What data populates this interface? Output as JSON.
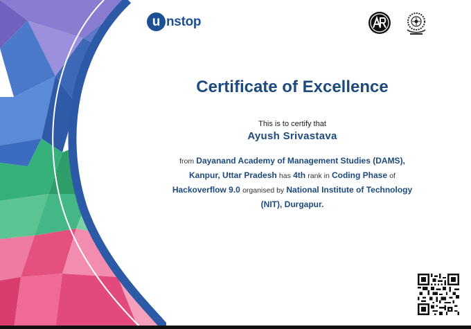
{
  "brand": {
    "unstop_letter": "u",
    "unstop_rest": "nstop"
  },
  "certificate": {
    "title": "Certificate of Excellence",
    "intro": "This is to certify that",
    "recipient": "Ayush Srivastava",
    "text": {
      "from": "from",
      "institution": "Dayanand Academy of Management Studies (DAMS), Kanpur, Uttar Pradesh",
      "has": "has",
      "rank": "4th",
      "rank_in": "rank in",
      "phase": "Coding Phase",
      "of": "of",
      "event": "Hackoverflow 9.0",
      "organised_by": "organised by",
      "organiser": "National Institute of Technology (NIT), Durgapur."
    }
  },
  "colors": {
    "title": "#1d4a7e",
    "unstop_brand": "#1c4f93",
    "purple": "#7b6cc4",
    "blue": "#3f6fc1",
    "green": "#3aab79",
    "pink": "#e4517f"
  },
  "icons": {
    "ar_logo": "ar-logo-icon",
    "nit_logo": "nit-durgapur-emblem-icon",
    "qr": "qr-code-icon"
  }
}
